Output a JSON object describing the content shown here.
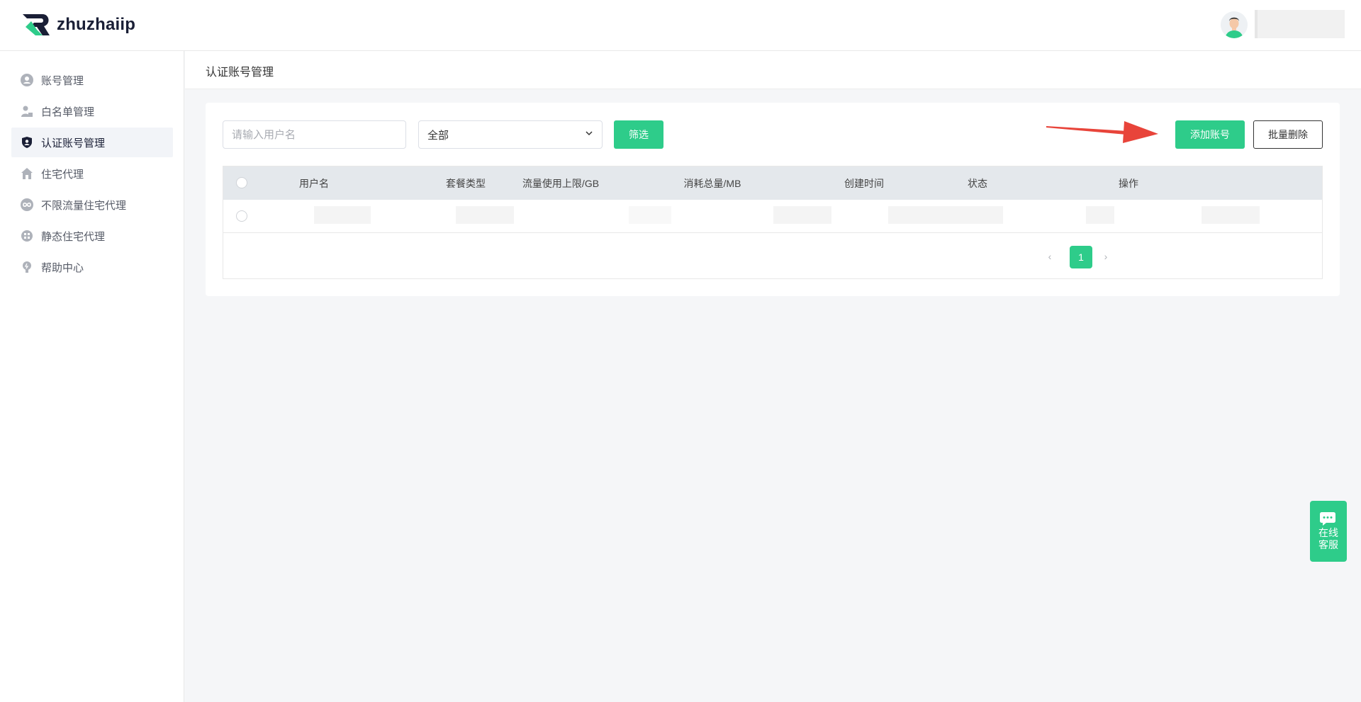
{
  "header": {
    "logo_text": "zhuzhaiip"
  },
  "sidebar": {
    "items": [
      {
        "label": "账号管理",
        "icon": "user-circle-icon"
      },
      {
        "label": "白名单管理",
        "icon": "user-lock-icon"
      },
      {
        "label": "认证账号管理",
        "icon": "shield-user-icon",
        "active": true
      },
      {
        "label": "住宅代理",
        "icon": "house-icon"
      },
      {
        "label": "不限流量住宅代理",
        "icon": "infinity-icon"
      },
      {
        "label": "静态住宅代理",
        "icon": "globe-grid-icon"
      },
      {
        "label": "帮助中心",
        "icon": "lightbulb-icon"
      }
    ]
  },
  "breadcrumb": {
    "title": "认证账号管理"
  },
  "toolbar": {
    "search_placeholder": "请输入用户名",
    "select_value": "全部",
    "filter_label": "筛选",
    "add_label": "添加账号",
    "batch_delete_label": "批量删除"
  },
  "table": {
    "columns": [
      "用户名",
      "套餐类型",
      "流量使用上限/GB",
      "消耗总量/MB",
      "创建时间",
      "状态",
      "操作"
    ]
  },
  "pagination": {
    "current_page": "1",
    "prev": "‹",
    "next": "›"
  },
  "float_chat": {
    "line1": "在线",
    "line2": "客服"
  },
  "colors": {
    "accent": "#2ecc8a",
    "arrow": "#e8443a",
    "header_row": "#e4e8ec"
  }
}
